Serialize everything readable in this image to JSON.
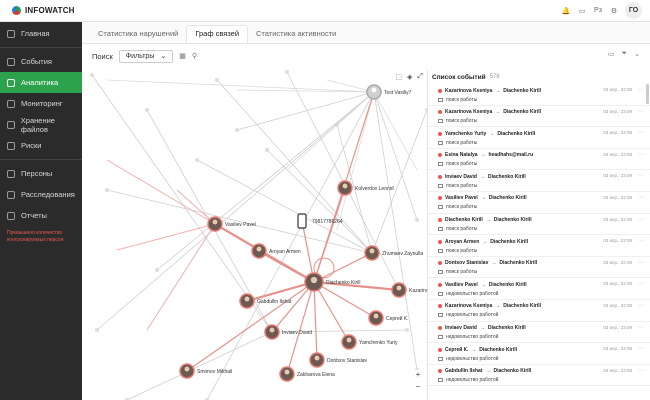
{
  "brand": {
    "name": "INFOWATCH"
  },
  "header": {
    "user_initials": "ГО",
    "icons": [
      "bell-icon",
      "monitor-icon",
      "language-icon",
      "settings-icon"
    ],
    "lang": "Рз"
  },
  "sidebar": {
    "items": [
      {
        "label": "Главная",
        "active": false
      },
      {
        "label": "События",
        "active": false
      },
      {
        "label": "Аналитика",
        "active": true
      },
      {
        "label": "Мониторинг",
        "active": false
      },
      {
        "label": "Хранение файлов",
        "active": false
      },
      {
        "label": "Риски",
        "active": false
      },
      {
        "label": "Персоны",
        "active": false
      },
      {
        "label": "Расследования",
        "active": false
      },
      {
        "label": "Отчеты",
        "active": false
      }
    ],
    "note": "Превышено количество контролируемых персон"
  },
  "tabs": [
    {
      "label": "Статистика нарушений",
      "active": false
    },
    {
      "label": "Граф связей",
      "active": true
    },
    {
      "label": "Статистика активности",
      "active": false
    }
  ],
  "toolbar": {
    "search_label": "Поиск",
    "filter_label": "Фильтры"
  },
  "graph": {
    "nodes": [
      {
        "label": "Test Vasiliy7"
      },
      {
        "label": "Kolverdov Leonid"
      },
      {
        "label": "79817786264"
      },
      {
        "label": "Vasiliev Pavel"
      },
      {
        "label": "Aroyan Armen"
      },
      {
        "label": "Zhumaev Zaynulla"
      },
      {
        "label": "Diachenko Kirill"
      },
      {
        "label": "Kazarinova"
      },
      {
        "label": "Gabdullin Ilshat"
      },
      {
        "label": "Сергей К."
      },
      {
        "label": "Inviaev David"
      },
      {
        "label": "Yamchenko Yuriy"
      },
      {
        "label": "Dontsov Stanislav"
      },
      {
        "label": "Zakharova Elena"
      },
      {
        "label": "Smirnov Mikhail"
      }
    ]
  },
  "events": {
    "title": "Список событий",
    "count": "578",
    "items": [
      {
        "from": "Kazarinova Kseniya",
        "to": "Diachenko Kirill",
        "subject": "поиск работы",
        "date": "03 апр., 22:08"
      },
      {
        "from": "Kazarinova Kseniya",
        "to": "Diachenko Kirill",
        "subject": "поиск работы",
        "date": "03 апр., 22:08"
      },
      {
        "from": "Yamchenko Yuriy",
        "to": "Diachenko Kirill",
        "subject": "поиск работы",
        "date": "03 апр., 22:08"
      },
      {
        "from": "Esina Natalya",
        "to": "headhahs@mail.ru",
        "subject": "поиск работы",
        "date": "03 апр., 22:08"
      },
      {
        "from": "Inviaev David",
        "to": "Diachenko Kirill",
        "subject": "поиск работы",
        "date": "03 апр., 22:08"
      },
      {
        "from": "Vasiliev Pavel",
        "to": "Diachenko Kirill",
        "subject": "поиск работы",
        "date": "03 апр., 22:08"
      },
      {
        "from": "Diachenko Kirill",
        "to": "Diachenko Kirill",
        "subject": "поиск работы",
        "date": "03 апр., 22:08"
      },
      {
        "from": "Aroyan Armen",
        "to": "Diachenko Kirill",
        "subject": "поиск работы",
        "date": "03 апр., 22:08"
      },
      {
        "from": "Dontsov Stanislav",
        "to": "Diachenko Kirill",
        "subject": "поиск работы",
        "date": "03 апр., 22:08"
      },
      {
        "from": "Vasiliev Pavel",
        "to": "Diachenko Kirill",
        "subject": "недовольство работой",
        "date": "03 апр., 22:08"
      },
      {
        "from": "Kazarinova Kseniya",
        "to": "Diachenko Kirill",
        "subject": "недовольство работой",
        "date": "03 апр., 22:08"
      },
      {
        "from": "Inviaev David",
        "to": "Diachenko Kirill",
        "subject": "недовольство работой",
        "date": "03 апр., 22:08"
      },
      {
        "from": "Сергей К.",
        "to": "Diachenko Kirill",
        "subject": "недовольство работой",
        "date": "03 апр., 22:08"
      },
      {
        "from": "Gabdullin Ilshat",
        "to": "Diachenko Kirill",
        "subject": "недовольство работой",
        "date": "03 апр., 22:08"
      }
    ]
  }
}
